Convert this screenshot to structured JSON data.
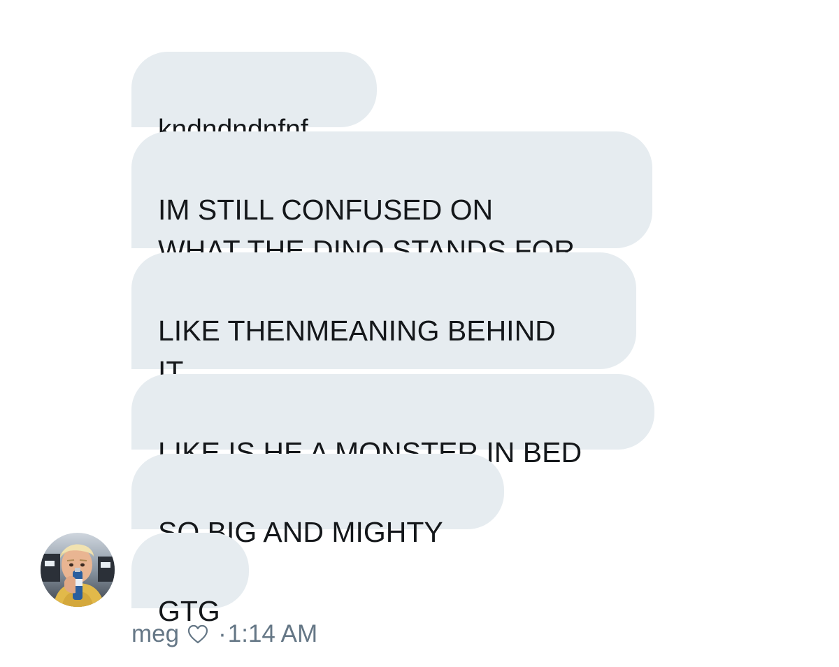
{
  "messages": [
    {
      "text": "kndndndnfnf"
    },
    {
      "text": "IM STILL CONFUSED ON\nWHAT THE DINO STANDS FOR"
    },
    {
      "text": "LIKE THENMEANING BEHIND\nIT"
    },
    {
      "text": "LIKE IS HE A MONSTER IN BED"
    },
    {
      "text": "SO BIG AND MIGHTY"
    },
    {
      "text": "GTG"
    }
  ],
  "footer": {
    "sender_name": "meg",
    "like_icon": "heart-outline-icon",
    "separator": "·",
    "time": "1:14 AM"
  },
  "colors": {
    "bubble": "#e6ecf0",
    "text": "#14171a",
    "meta_text": "#657786"
  }
}
